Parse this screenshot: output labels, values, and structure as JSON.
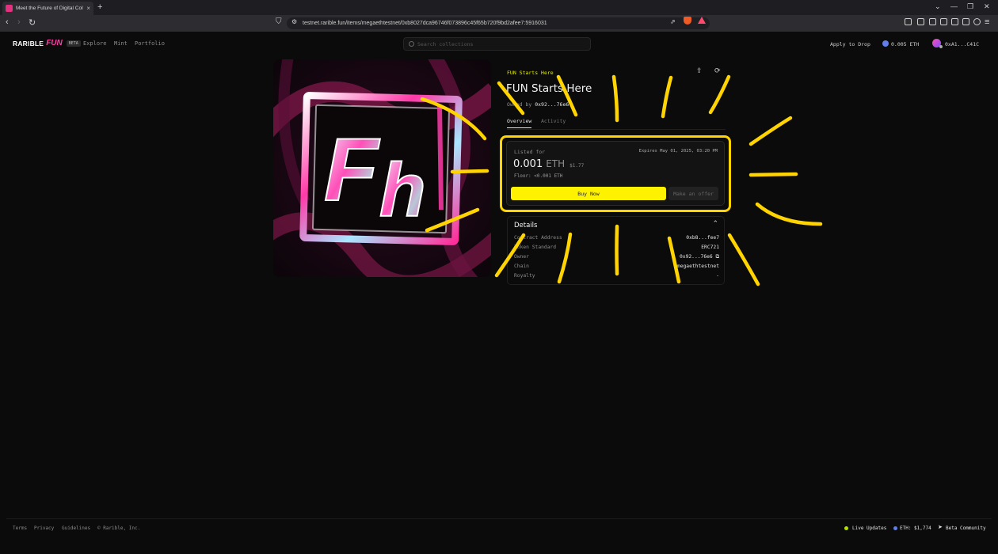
{
  "browser": {
    "tab_title": "Meet the Future of Digital Colle",
    "tab_close": "×",
    "new_tab": "+",
    "url": "testnet.rarible.fun/items/megaethtestnet/0xb8027dca96746f073896c45f65b720f9bd2afee7:5916031",
    "window_controls": [
      "⌄",
      "—",
      "❐",
      "✕"
    ]
  },
  "site": {
    "logo_main": "RARIBLE",
    "logo_fun": "FUN",
    "logo_badge": "BETA",
    "nav": [
      "Explore",
      "Mint",
      "Portfolio"
    ],
    "search_placeholder": "Search collections",
    "apply_to_drop": "Apply to Drop",
    "balance": "0.005 ETH",
    "wallet": "0xA1...C41C"
  },
  "item": {
    "collection": "FUN Starts Here",
    "title": "FUN Starts Here",
    "owned_by_label": "Owned by",
    "owner_short": "0x92...76e6",
    "tabs": [
      "Overview",
      "Activity"
    ],
    "artwork_letters": "Fh"
  },
  "listing": {
    "label": "Listed for",
    "expires": "Expires May 01, 2025, 03:20 PM",
    "price": "0.001",
    "symbol": "ETH",
    "usd": "$1.77",
    "floor": "Floor: <0.001 ETH",
    "buy_label": "Buy Now",
    "offer_label": "Make an offer"
  },
  "details": {
    "title": "Details",
    "rows": [
      {
        "key": "Contract Address",
        "value": "0xb8...fee7"
      },
      {
        "key": "Token Standard",
        "value": "ERC721"
      },
      {
        "key": "Owner",
        "value": "0x92...76e6 ⧉"
      },
      {
        "key": "Chain",
        "value": "megaethtestnet"
      },
      {
        "key": "Royalty",
        "value": "-"
      }
    ]
  },
  "footer": {
    "links": [
      "Terms",
      "Privacy",
      "Guidelines",
      "© Rarible, Inc."
    ],
    "live_updates": "Live Updates",
    "eth_price": "ETH: $1,774",
    "community": "Beta Community"
  },
  "colors": {
    "accent": "#fff200",
    "brand_pink": "#ff3ea5",
    "highlight": "#ffd400",
    "background": "#0b0b0b"
  }
}
